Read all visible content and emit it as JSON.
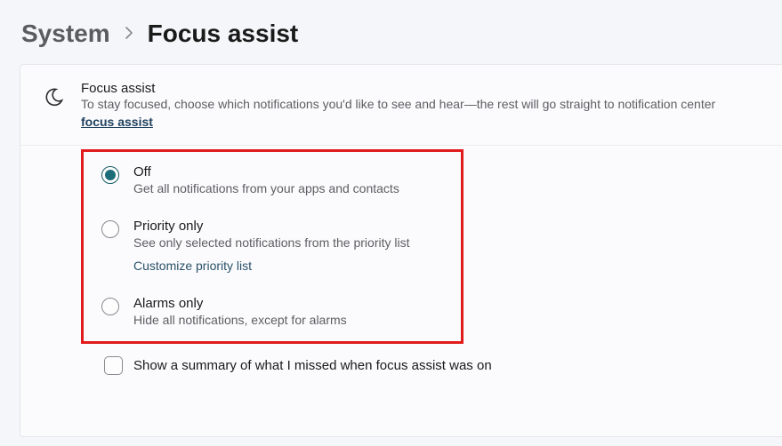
{
  "breadcrumb": {
    "parent": "System",
    "current": "Focus assist"
  },
  "header": {
    "title": "Focus assist",
    "description": "To stay focused, choose which notifications you'd like to see and hear—the rest will go straight to notification center",
    "link": "focus assist"
  },
  "options": {
    "selected": "off",
    "off": {
      "label": "Off",
      "description": "Get all notifications from your apps and contacts"
    },
    "priority": {
      "label": "Priority only",
      "description": "See only selected notifications from the priority list",
      "customize": "Customize priority list"
    },
    "alarms": {
      "label": "Alarms only",
      "description": "Hide all notifications, except for alarms"
    }
  },
  "summary_checkbox": {
    "checked": false,
    "label": "Show a summary of what I missed when focus assist was on"
  }
}
